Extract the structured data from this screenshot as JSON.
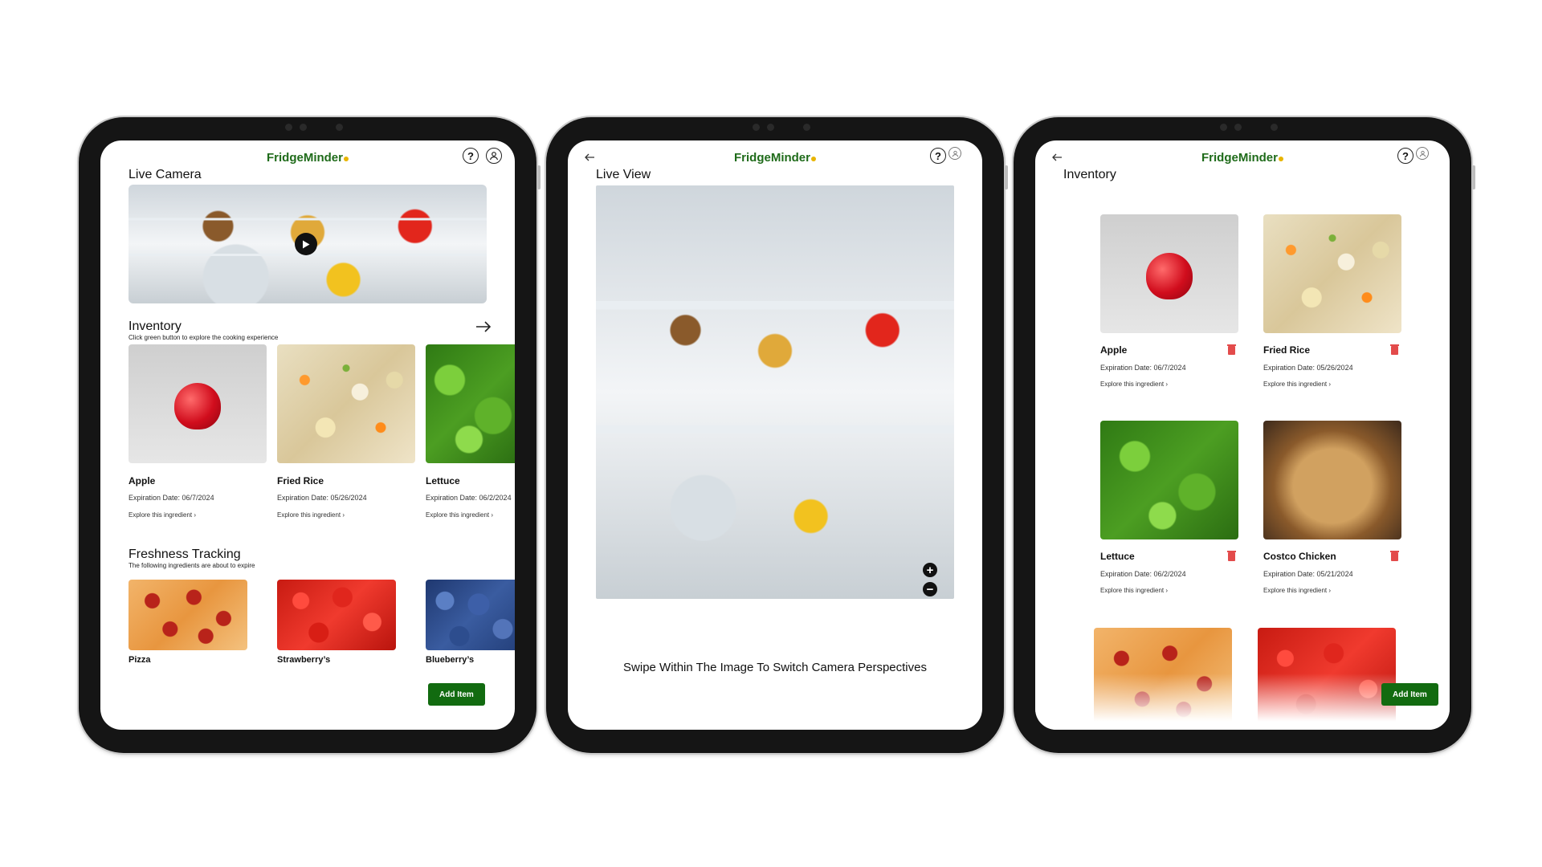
{
  "app": {
    "name": "FridgeMinder"
  },
  "tablet1": {
    "live_camera_title": "Live Camera",
    "inventory_title": "Inventory",
    "inventory_subtitle": "Click green button to explore the cooking experience",
    "items": [
      {
        "name": "Apple",
        "date": "Expiration Date: 06/7/2024",
        "link": "Explore this ingredient"
      },
      {
        "name": "Fried Rice",
        "date": "Expiration Date: 05/26/2024",
        "link": "Explore this ingredient"
      },
      {
        "name": "Lettuce",
        "date": "Expiration Date: 06/2/2024",
        "link": "Explore this ingredient"
      }
    ],
    "freshness_title": "Freshness Tracking",
    "freshness_subtitle": "The following ingredients are about to expire",
    "expiring": [
      {
        "name": "Pizza"
      },
      {
        "name": "Strawberry’s"
      },
      {
        "name": "Blueberry’s"
      }
    ],
    "add_button": "Add Item"
  },
  "tablet2": {
    "title": "Live View",
    "caption": "Swipe Within The Image To Switch Camera Perspectives",
    "zoom_in": "+",
    "zoom_out": "−"
  },
  "tablet3": {
    "title": "Inventory",
    "items": [
      {
        "name": "Apple",
        "date": "Expiration Date: 06/7/2024",
        "link": "Explore this ingredient"
      },
      {
        "name": "Fried Rice",
        "date": "Expiration Date: 05/26/2024",
        "link": "Explore this ingredient"
      },
      {
        "name": "Lettuce",
        "date": "Expiration Date: 06/2/2024",
        "link": "Explore this ingredient"
      },
      {
        "name": "Costco Chicken",
        "date": "Expiration Date: 05/21/2024",
        "link": "Explore this ingredient"
      }
    ],
    "add_button": "Add Item"
  },
  "icons": {
    "help": "question-mark-circle",
    "profile": "user-circle",
    "back": "arrow-left",
    "forward": "arrow-right",
    "play": "play-button",
    "chevron": "chevron-right",
    "delete": "trash"
  },
  "colors": {
    "brand_green": "#1f6b1a",
    "button_green": "#126b10",
    "logo_dot": "#e8b400",
    "trash_red": "#e34b4b"
  }
}
